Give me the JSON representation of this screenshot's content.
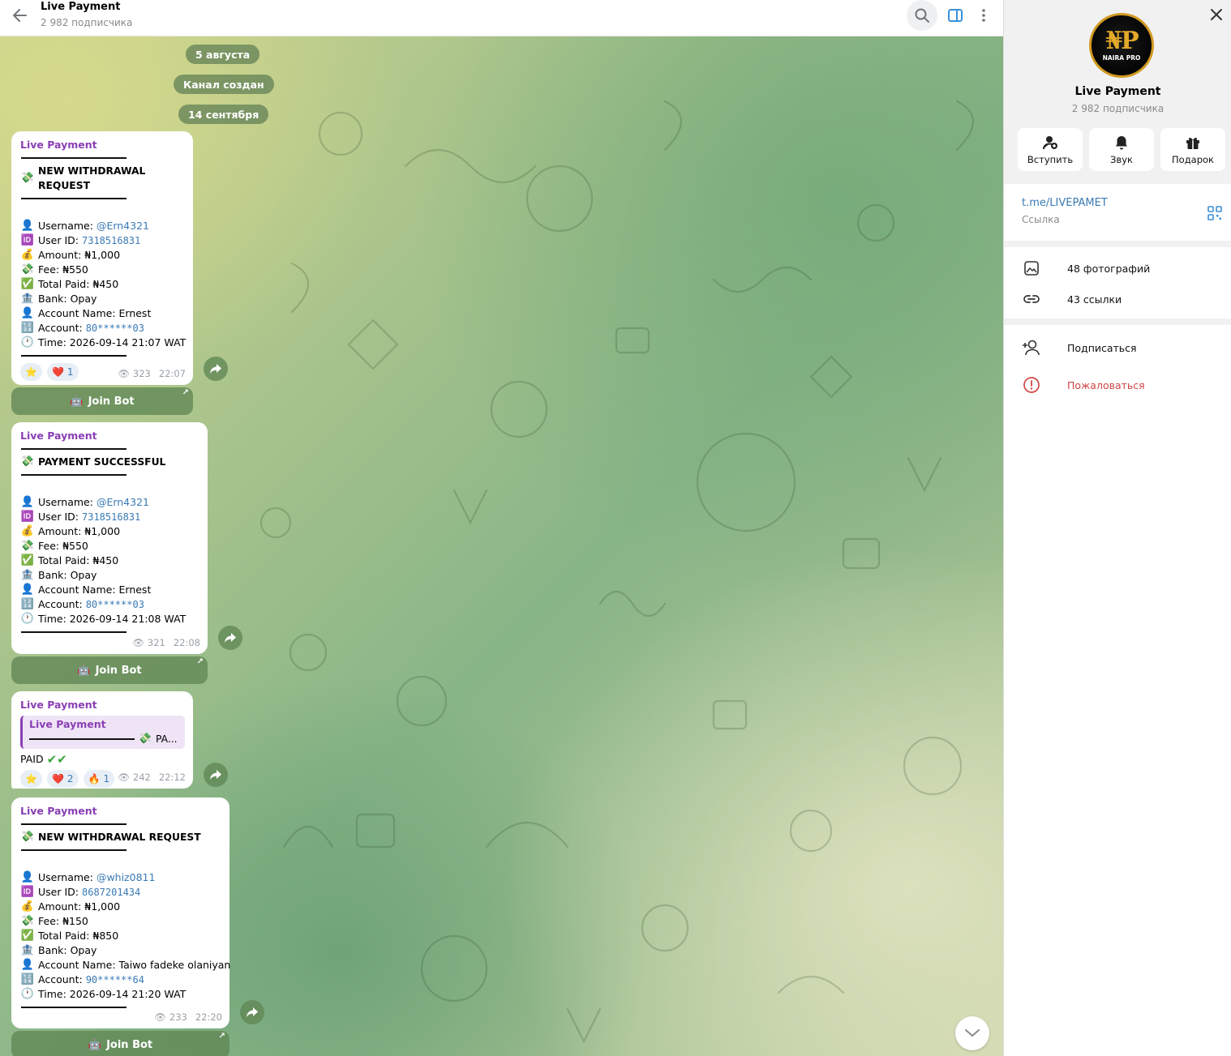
{
  "header": {
    "title": "Live Payment",
    "subtitle": "2 982 подписчика"
  },
  "dates": [
    "5 августа",
    "Канал создан",
    "14 сентября"
  ],
  "join_bot_label": "Join Bot",
  "messages": [
    {
      "author": "Live Payment",
      "heading": "NEW WITHDRAWAL REQUEST",
      "username_label": "Username:",
      "username": "@Ern4321",
      "userid_label": "User ID:",
      "userid": "7318516831",
      "amount": "Amount: ₦1,000",
      "fee": "Fee: ₦550",
      "total": "Total Paid: ₦450",
      "bank": "Bank: Opay",
      "account_name": "Account Name: Ernest",
      "account_label": "Account:",
      "account": "80******03",
      "time": "Time: 2026-09-14 21:07 WAT",
      "views": "323",
      "clock": "22:07",
      "reactions": [
        {
          "emoji": "⭐",
          "count": ""
        },
        {
          "emoji": "❤️",
          "count": "1"
        }
      ]
    },
    {
      "author": "Live Payment",
      "heading": "PAYMENT SUCCESSFUL",
      "username_label": "Username:",
      "username": "@Ern4321",
      "userid_label": "User ID:",
      "userid": "7318516831",
      "amount": "Amount: ₦1,000",
      "fee": "Fee: ₦550",
      "total": "Total Paid: ₦450",
      "bank": "Bank: Opay",
      "account_name": "Account Name: Ernest",
      "account_label": "Account:",
      "account": "80******03",
      "time": "Time: 2026-09-14 21:08 WAT",
      "views": "321",
      "clock": "22:08"
    },
    {
      "author": "Live Payment",
      "reply_author": "Live Payment",
      "reply_snippet": "PA...",
      "text": "PAID",
      "views": "242",
      "clock": "22:12",
      "reactions": [
        {
          "emoji": "⭐",
          "count": ""
        },
        {
          "emoji": "❤️",
          "count": "2"
        },
        {
          "emoji": "🔥",
          "count": "1"
        }
      ]
    },
    {
      "author": "Live Payment",
      "heading": "NEW WITHDRAWAL REQUEST",
      "username_label": "Username:",
      "username": "@whiz0811",
      "userid_label": "User ID:",
      "userid": "8687201434",
      "amount": "Amount: ₦1,000",
      "fee": "Fee: ₦150",
      "total": "Total Paid: ₦850",
      "bank": "Bank: Opay",
      "account_name": "Account Name: Taiwo fadeke olaniyan",
      "account_label": "Account:",
      "account": "90******64",
      "time": "Time: 2026-09-14 21:20 WAT",
      "views": "233",
      "clock": "22:20"
    }
  ],
  "panel": {
    "title": "Live Payment",
    "subtitle": "2 982 подписчика",
    "logo_text": "NAIRA PRO",
    "actions": [
      {
        "icon": "join-icon",
        "label": "Вступить"
      },
      {
        "icon": "bell-icon",
        "label": "Звук"
      },
      {
        "icon": "gift-icon",
        "label": "Подарок"
      }
    ],
    "link": "t.me/LIVEPAMET",
    "link_label": "Ссылка",
    "photos": "48 фотографий",
    "links": "43 ссылки",
    "subscribe": "Подписаться",
    "report": "Пожаловаться"
  },
  "colors": {
    "author": "#8a3fb5",
    "link": "#3a7ab5",
    "danger": "#d24545",
    "pill": "#62805680"
  }
}
